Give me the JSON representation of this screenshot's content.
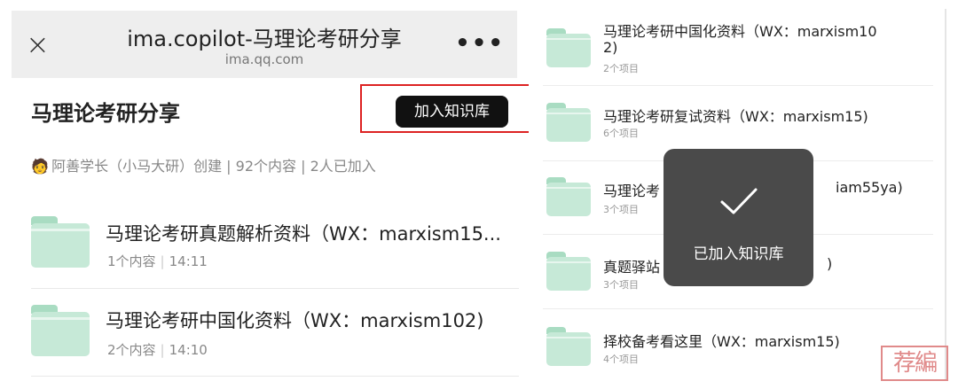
{
  "left": {
    "topbar": {
      "close_glyph": "×",
      "title": "ima.copilot-马理论考研分享",
      "url": "ima.qq.com",
      "more_glyph": "•••"
    },
    "kb_title": "马理论考研分享",
    "join_button": "加入知识库",
    "meta": {
      "avatar": "🧑",
      "text": "阿善学长（小马大研）创建 | 92个内容 | 2人已加入"
    },
    "items": [
      {
        "title": "马理论考研真题解析资料（WX：marxism15...",
        "count": "1个内容",
        "time": "14:11"
      },
      {
        "title": "马理论考研中国化资料（WX：marxism102)",
        "count": "2个内容",
        "time": "14:10"
      }
    ]
  },
  "right": {
    "items": [
      {
        "title_line1": "马理论考研中国化资料（WX：marxism10",
        "title_line2": "2)",
        "sub": "2个项目"
      },
      {
        "title_line1": "马理论考研复试资料（WX：marxism15)",
        "sub": "6个项目"
      },
      {
        "title_left": "马理论考",
        "title_right": "iam55ya)",
        "sub": "3个项目"
      },
      {
        "title_left": "真题驿站",
        "title_right": ")",
        "sub": "3个项目"
      },
      {
        "title_line1": "择校备考看这里（WX：marxism15)",
        "sub": "4个项目"
      }
    ],
    "toast": {
      "icon": "checkmark-icon",
      "text": "已加入知识库"
    }
  },
  "watermark": "荐編",
  "colors": {
    "folder_body": "#c6e9d7",
    "folder_tab": "#a9dcc2",
    "toast_bg": "#4a4a4a",
    "highlight": "#dd2222",
    "button_bg": "#111111"
  }
}
